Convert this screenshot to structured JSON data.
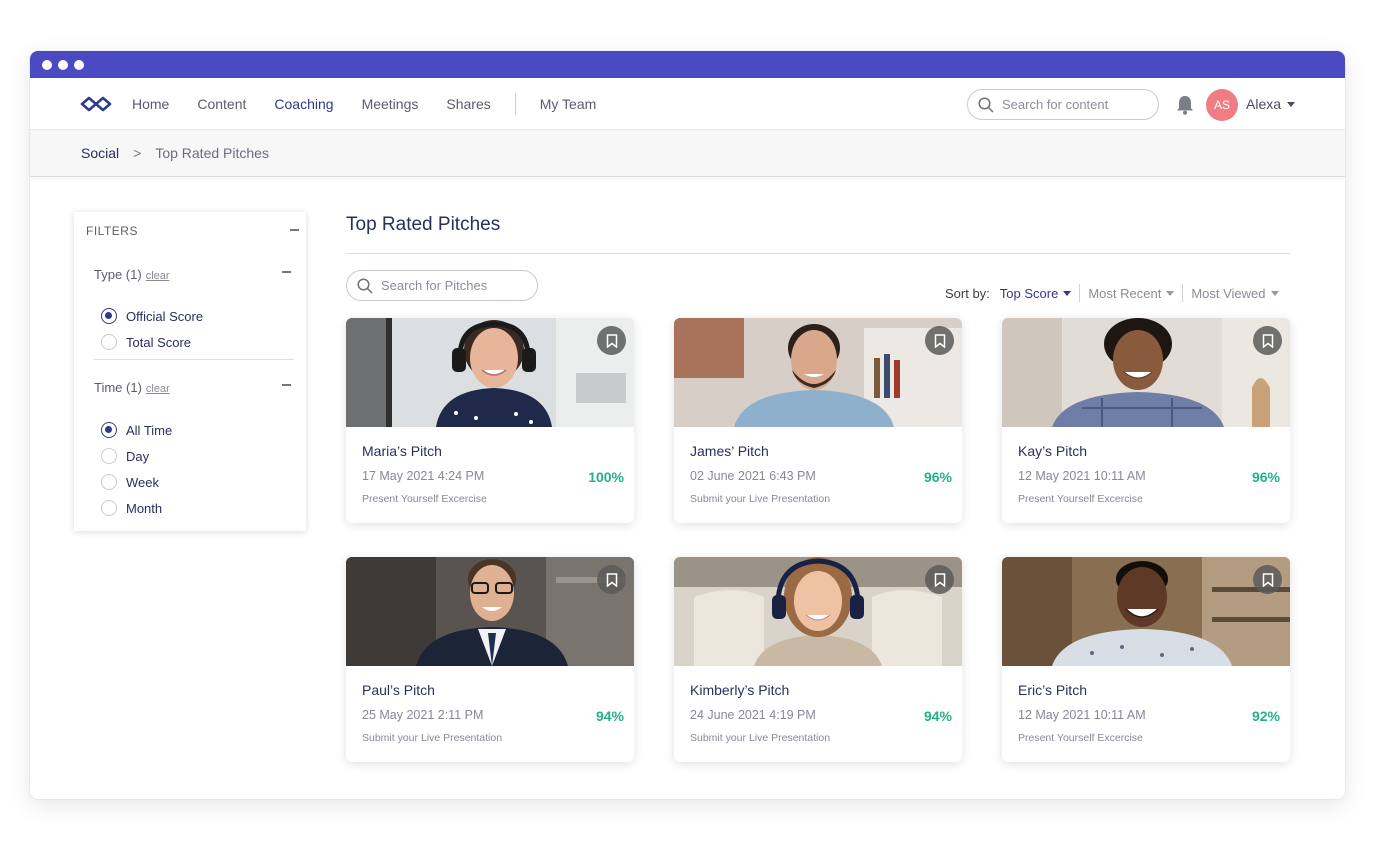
{
  "nav": {
    "items": [
      "Home",
      "Content",
      "Coaching",
      "Meetings",
      "Shares"
    ],
    "team": "My Team",
    "search_placeholder": "Search for content",
    "avatar_initials": "AS",
    "user_name": "Alexa"
  },
  "breadcrumb": {
    "root": "Social",
    "current": "Top Rated Pitches"
  },
  "filters": {
    "heading": "FILTERS",
    "type": {
      "title": "Type (1)",
      "clear": "clear",
      "options": [
        "Official Score",
        "Total Score"
      ],
      "selected": "Official Score"
    },
    "time": {
      "title": "Time (1)",
      "clear": "clear",
      "options": [
        "All Time",
        "Day",
        "Week",
        "Month"
      ],
      "selected": "All Time"
    }
  },
  "main": {
    "title": "Top Rated Pitches",
    "search_placeholder": "Search for Pitches",
    "sort": {
      "label": "Sort by:",
      "options": [
        "Top Score",
        "Most Recent",
        "Most Viewed"
      ],
      "active": "Top Score"
    }
  },
  "cards": [
    {
      "name": "Maria’s Pitch",
      "date": "17 May 2021 4:24 PM",
      "exercise": "Present Yourself Excercise",
      "score": "100%"
    },
    {
      "name": "James’ Pitch",
      "date": "02 June 2021 6:43 PM",
      "exercise": "Submit your Live Presentation",
      "score": "96%"
    },
    {
      "name": "Kay’s Pitch",
      "date": "12 May 2021 10:11 AM",
      "exercise": "Present Yourself Excercise",
      "score": "96%"
    },
    {
      "name": "Paul’s Pitch",
      "date": "25 May 2021 2:11 PM",
      "exercise": "Submit your Live Presentation",
      "score": "94%"
    },
    {
      "name": "Kimberly’s Pitch",
      "date": "24 June 2021 4:19 PM",
      "exercise": "Submit your Live Presentation",
      "score": "94%"
    },
    {
      "name": "Eric’s Pitch",
      "date": "12 May 2021 10:11 AM",
      "exercise": "Present Yourself Excercise",
      "score": "92%"
    }
  ],
  "colors": {
    "titlebar": "#4a4bc2",
    "accent": "#2f3a8f",
    "score": "#23b08a",
    "avatar": "#f07d84"
  }
}
